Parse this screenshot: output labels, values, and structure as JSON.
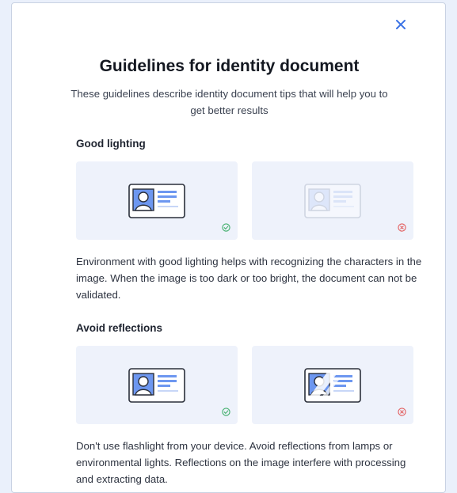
{
  "dialog": {
    "title": "Guidelines for identity document",
    "subtitle": "These guidelines describe identity document tips that will help you to get better results",
    "close_icon": "close-icon"
  },
  "sections": [
    {
      "title": "Good lighting",
      "good_example": {
        "icon": "id-card-icon",
        "status_icon": "check-circle-icon"
      },
      "bad_example": {
        "icon": "id-card-faded-icon",
        "status_icon": "x-circle-icon"
      },
      "description": "Environment with good lighting helps with recognizing the characters in the image. When the image is too dark or too bright, the document can not be validated."
    },
    {
      "title": "Avoid reflections",
      "good_example": {
        "icon": "id-card-icon",
        "status_icon": "check-circle-icon"
      },
      "bad_example": {
        "icon": "id-card-glare-icon",
        "status_icon": "x-circle-icon"
      },
      "description": "Don't use flashlight from your device. Avoid reflections from lamps or environmental lights. Reflections on the image interfere with processing and extracting data."
    }
  ],
  "colors": {
    "accent": "#3b73e6",
    "good": "#3fae6a",
    "bad": "#e25a5a",
    "card_bg": "#eef2fb"
  }
}
